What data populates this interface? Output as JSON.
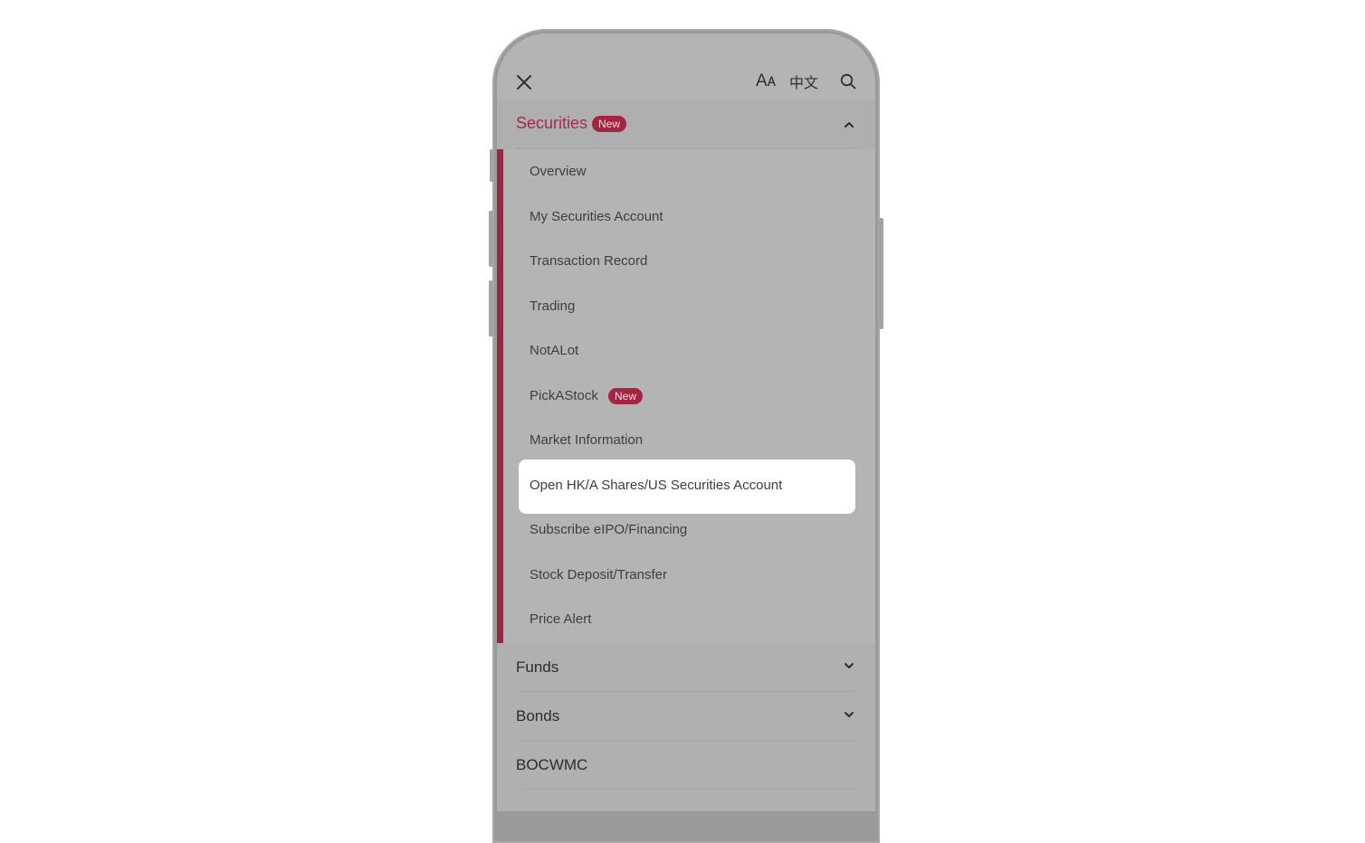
{
  "header": {
    "close_icon": "close-icon",
    "font_size_label": "Aᴀ",
    "language_label": "中文",
    "search_icon": "search-icon"
  },
  "colors": {
    "accent": "#a42a48",
    "badge_bg": "#a52444",
    "overlay_bg": "#b4b4b4",
    "highlight_bg": "#ffffff"
  },
  "menu": {
    "expanded_section": {
      "label": "Securities",
      "badge": "New",
      "state": "expanded",
      "items": [
        {
          "label": "Overview"
        },
        {
          "label": "My Securities Account"
        },
        {
          "label": "Transaction Record"
        },
        {
          "label": "Trading"
        },
        {
          "label": "NotALot"
        },
        {
          "label": "PickAStock",
          "badge": "New"
        },
        {
          "label": "Market Information"
        },
        {
          "label": "Open HK/A Shares/US Securities Account",
          "highlighted": true
        },
        {
          "label": "Subscribe eIPO/Financing"
        },
        {
          "label": "Stock Deposit/Transfer"
        },
        {
          "label": "Price Alert"
        }
      ]
    },
    "sections": [
      {
        "label": "Funds",
        "expandable": true
      },
      {
        "label": "Bonds",
        "expandable": true
      },
      {
        "label": "BOCWMC",
        "expandable": false
      }
    ]
  }
}
